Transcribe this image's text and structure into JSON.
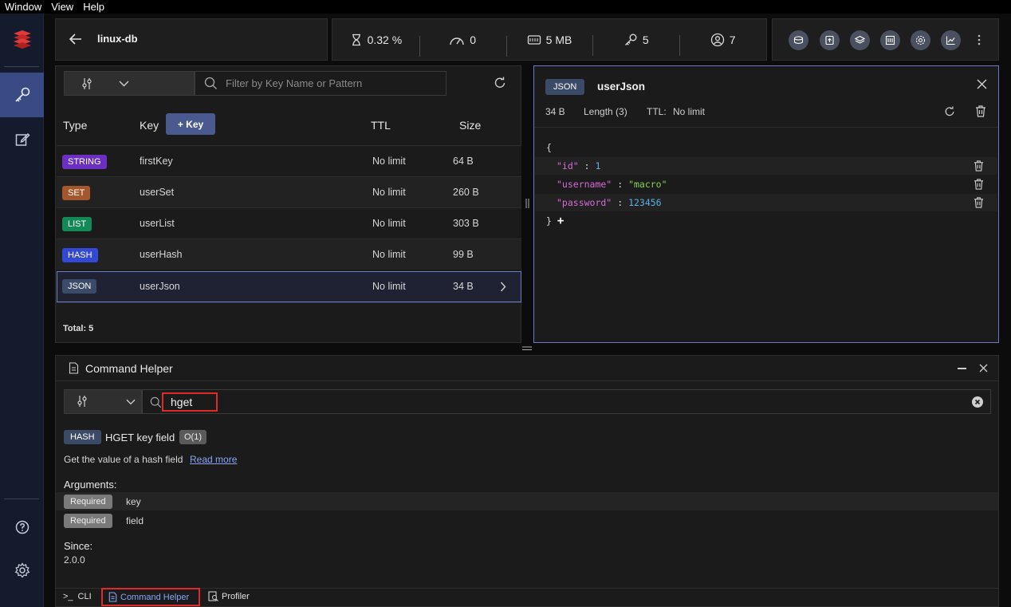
{
  "menu": [
    "Window",
    "View",
    "Help"
  ],
  "db": {
    "name": "linux-db"
  },
  "stats": {
    "cpu": "0.32 %",
    "ops": "0",
    "memory": "5 MB",
    "keys": "5",
    "clients": "7"
  },
  "tools": [
    "memory-analysis-icon",
    "upload-icon",
    "layers-icon",
    "workbench-icon",
    "settings-icon",
    "analytics-icon"
  ],
  "keylist": {
    "filter_placeholder": "Filter by Key Name or Pattern",
    "headers": {
      "type": "Type",
      "key": "Key",
      "add_key": "+ Key",
      "ttl": "TTL",
      "size": "Size"
    },
    "rows": [
      {
        "type": "STRING",
        "color": "#6b2fc1",
        "key": "firstKey",
        "ttl": "No limit",
        "size": "64 B"
      },
      {
        "type": "SET",
        "color": "#a4572c",
        "key": "userSet",
        "ttl": "No limit",
        "size": "260 B"
      },
      {
        "type": "LIST",
        "color": "#138a56",
        "key": "userList",
        "ttl": "No limit",
        "size": "303 B"
      },
      {
        "type": "HASH",
        "color": "#3448d6",
        "key": "userHash",
        "ttl": "No limit",
        "size": "99 B"
      },
      {
        "type": "JSON",
        "color": "#3b4a66",
        "key": "userJson",
        "ttl": "No limit",
        "size": "34 B"
      }
    ],
    "total": "Total: 5"
  },
  "json": {
    "badge": "JSON",
    "key": "userJson",
    "size": "34 B",
    "length": "Length (3)",
    "ttl_label": "TTL:",
    "ttl_value": "No limit",
    "open": "{",
    "close": "}",
    "add": "+",
    "entries": [
      {
        "key": "\"id\"",
        "colon": ":",
        "value": "1",
        "kind": "num"
      },
      {
        "key": "\"username\"",
        "colon": ":",
        "value": "\"macro\"",
        "kind": "str"
      },
      {
        "key": "\"password\"",
        "colon": ":",
        "value": "123456",
        "kind": "num"
      }
    ]
  },
  "helper": {
    "title": "Command Helper",
    "search_value": "hget",
    "group": "HASH",
    "command": "HGET key field",
    "complexity": "O(1)",
    "summary": "Get the value of a hash field",
    "read_more": "Read more",
    "arguments_label": "Arguments:",
    "arguments": [
      {
        "tag": "Required",
        "name": "key"
      },
      {
        "tag": "Required",
        "name": "field"
      }
    ],
    "since_label": "Since:",
    "since_value": "2.0.0"
  },
  "bottom_tabs": {
    "cli": "CLI",
    "cli_prompt": ">_",
    "helper": "Command Helper",
    "profiler": "Profiler"
  },
  "colors": {
    "accent": "#6c79c4",
    "highlight": "#e02a2a",
    "link": "#8aa4f5"
  }
}
